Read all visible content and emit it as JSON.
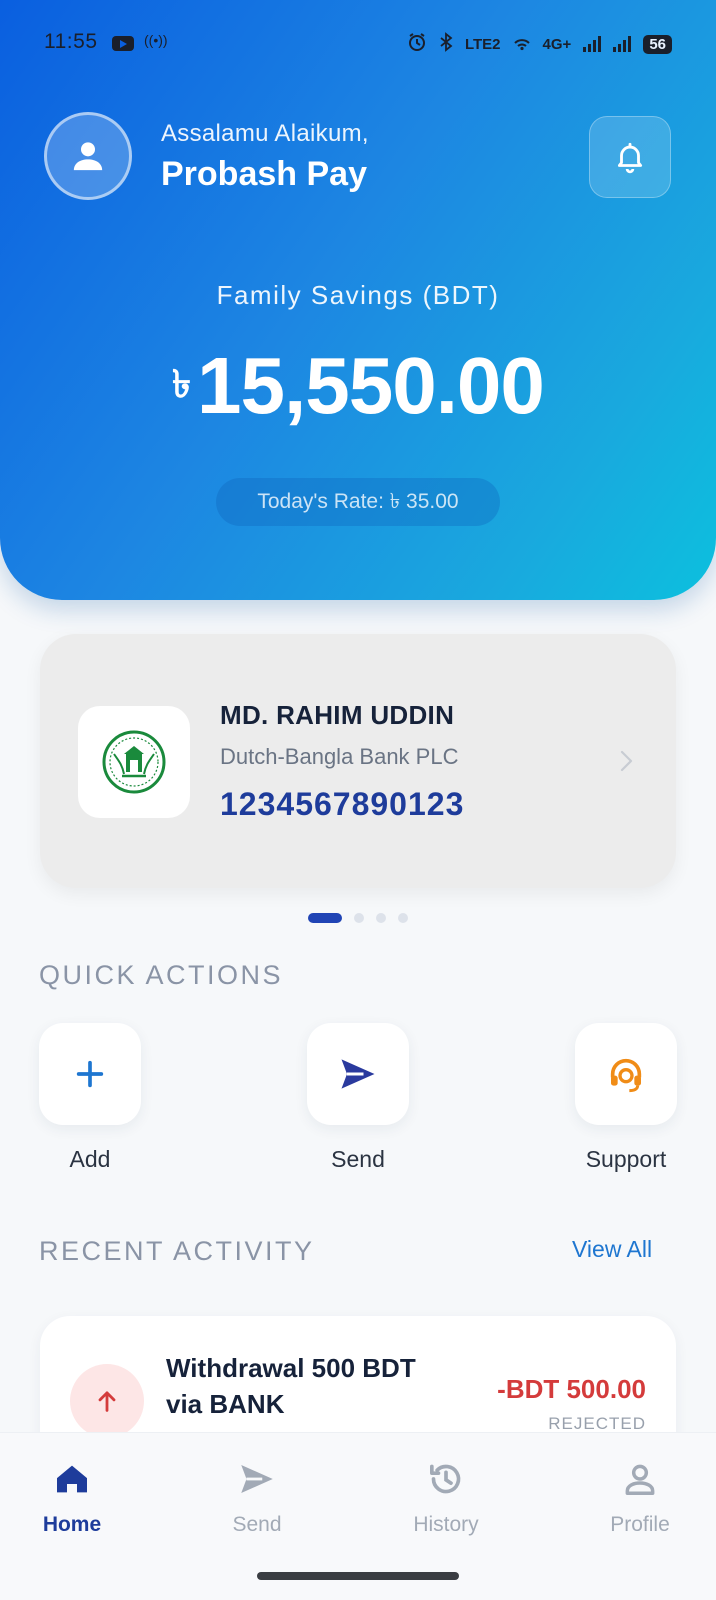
{
  "status_bar": {
    "time": "11:55",
    "network": "4G+",
    "volte": "LTE2",
    "battery": "56"
  },
  "header": {
    "greeting": "Assalamu Alaikum,",
    "user_name": "Probash Pay",
    "balance_label": "Family Savings (BDT)",
    "currency_symbol": "৳",
    "balance_amount": "15,550.00",
    "rate_text": "Today's Rate: ৳ 35.00"
  },
  "account_card": {
    "holder_name": "MD. RAHIM UDDIN",
    "bank_name": "Dutch-Bangla Bank PLC",
    "account_number": "1234567890123",
    "pager": {
      "count": 4,
      "active_index": 0
    }
  },
  "quick_actions": {
    "title": "QUICK ACTIONS",
    "items": [
      {
        "label": "Add",
        "icon": "plus-icon",
        "color": "#1e76d0"
      },
      {
        "label": "Send",
        "icon": "paper-plane-icon",
        "color": "#2a3a9e"
      },
      {
        "label": "Support",
        "icon": "headset-icon",
        "color": "#f08c17"
      }
    ]
  },
  "recent_activity": {
    "title": "RECENT ACTIVITY",
    "view_all": "View All",
    "items": [
      {
        "title": "Withdrawal 500 BDT via BANK",
        "amount": "-BDT 500.00",
        "status": "REJECTED",
        "icon": "arrow-up-icon",
        "amount_color": "#d43b3b"
      }
    ]
  },
  "bottom_nav": {
    "items": [
      {
        "label": "Home",
        "icon": "home-icon",
        "active": true
      },
      {
        "label": "Send",
        "icon": "send-icon",
        "active": false
      },
      {
        "label": "History",
        "icon": "history-icon",
        "active": false
      },
      {
        "label": "Profile",
        "icon": "profile-icon",
        "active": false
      }
    ]
  },
  "colors": {
    "primary": "#1e3c9b",
    "header_gradient_start": "#0a5fe0",
    "header_gradient_end": "#0cc0de",
    "negative": "#d43b3b"
  }
}
